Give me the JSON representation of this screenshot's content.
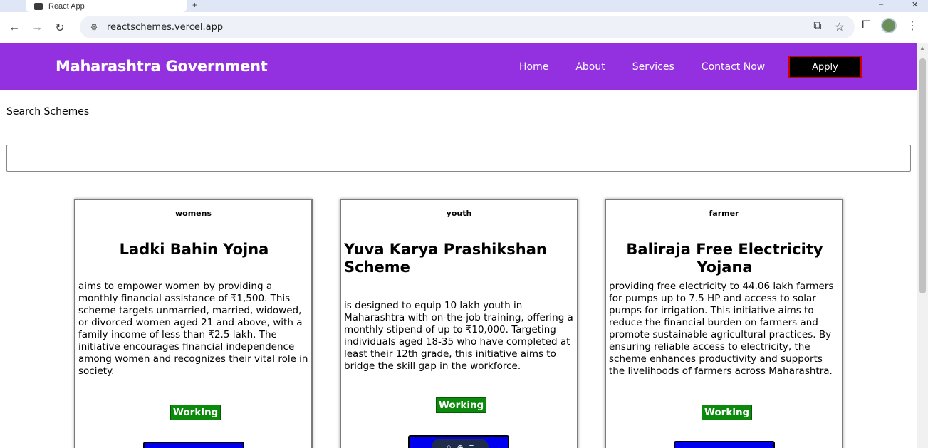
{
  "browser": {
    "tab_title": "React App",
    "url": "reactschemes.vercel.app"
  },
  "navbar": {
    "brand": "Maharashtra Government",
    "links": [
      "Home",
      "About",
      "Services",
      "Contact Now"
    ],
    "apply": "Apply"
  },
  "search": {
    "label": "Search Schemes",
    "value": "",
    "placeholder": ""
  },
  "cards": [
    {
      "category": "womens",
      "title": "Ladki Bahin Yojna",
      "description": "aims to empower women by providing a monthly financial assistance of ₹1,500. This scheme targets unmarried, married, widowed, or divorced women aged 21 and above, with a family income of less than ₹2.5 lakh. The initiative encourages financial independence among women and recognizes their vital role in society.",
      "status": "Working"
    },
    {
      "category": "youth",
      "title": "Yuva Karya Prashikshan Scheme",
      "description": "is designed to equip 10 lakh youth in Maharashtra with on-the-job training, offering a monthly stipend of up to ₹10,000. Targeting individuals aged 18-35 who have completed at least their 12th grade, this initiative aims to bridge the skill gap in the workforce.",
      "status": "Working"
    },
    {
      "category": "farmer",
      "title": "Baliraja Free Electricity Yojana",
      "description": "providing free electricity to 44.06 lakh farmers for pumps up to 7.5 HP and access to solar pumps for irrigation. This initiative aims to reduce the financial burden on farmers and promote sustainable agricultural practices. By ensuring reliable access to electricity, the scheme enhances productivity and supports the livelihoods of farmers across Maharashtra.",
      "status": "Working"
    }
  ],
  "colors": {
    "navbar": "#9330e0",
    "status": "#0c8a0c",
    "card_button": "#0000ee",
    "apply_button": "#000000"
  }
}
